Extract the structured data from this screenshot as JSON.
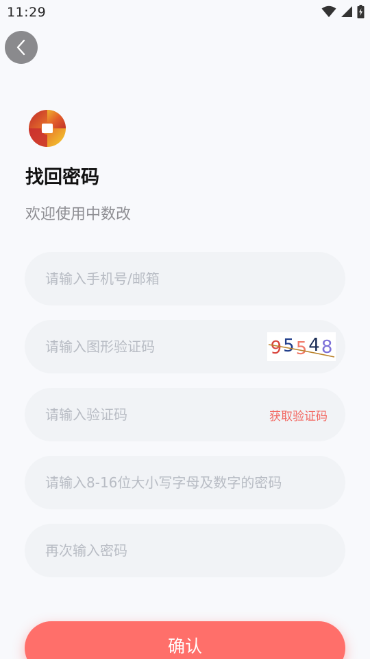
{
  "status_bar": {
    "time": "11:29"
  },
  "header": {
    "title": "找回密码",
    "subtitle": "欢迎使用中数改"
  },
  "form": {
    "phone_placeholder": "请输入手机号/邮箱",
    "captcha_placeholder": "请输入图形验证码",
    "captcha_digits": [
      "9",
      "5",
      "5",
      "4",
      "8"
    ],
    "captcha_colors": [
      "#d9463e",
      "#1f3d8a",
      "#f07a6a",
      "#1a2c55",
      "#7b6fd8"
    ],
    "code_placeholder": "请输入验证码",
    "get_code_label": "获取验证码",
    "password_placeholder": "请输入8-16位大小写字母及数字的密码",
    "confirm_password_placeholder": "再次输入密码",
    "confirm_label": "确认"
  },
  "colors": {
    "accent": "#ff6f6a",
    "background": "#f8f9fc",
    "field_background": "#f1f3f6"
  },
  "icons": {
    "back": "chevron-left-icon",
    "logo": "app-logo-icon"
  }
}
